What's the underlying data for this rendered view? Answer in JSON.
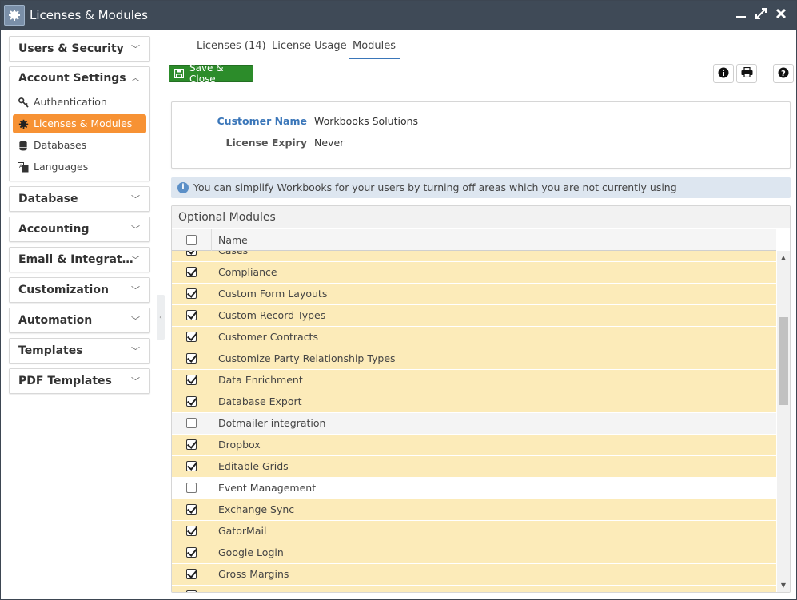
{
  "window": {
    "title": "Licenses & Modules"
  },
  "sidebar": {
    "groups": [
      {
        "label": "Users & Security"
      },
      {
        "label": "Account Settings",
        "items": [
          {
            "label": "Authentication",
            "icon": "key-icon"
          },
          {
            "label": "Licenses & Modules",
            "icon": "gear-icon",
            "active": true
          },
          {
            "label": "Databases",
            "icon": "database-icon"
          },
          {
            "label": "Languages",
            "icon": "language-icon"
          }
        ]
      },
      {
        "label": "Database"
      },
      {
        "label": "Accounting"
      },
      {
        "label": "Email & Integrat…"
      },
      {
        "label": "Customization"
      },
      {
        "label": "Automation"
      },
      {
        "label": "Templates"
      },
      {
        "label": "PDF Templates"
      }
    ]
  },
  "tabs": [
    {
      "label": "Licenses (14)"
    },
    {
      "label": "License Usage"
    },
    {
      "label": "Modules",
      "active": true
    }
  ],
  "toolbar": {
    "save_label": "Save & Close"
  },
  "details": {
    "customer_name_label": "Customer Name",
    "customer_name_value": "Workbooks Solutions",
    "license_expiry_label": "License Expiry",
    "license_expiry_value": "Never"
  },
  "notice": "You can simplify Workbooks for your users by turning off areas which you are not currently using",
  "modules": {
    "title": "Optional Modules",
    "column_name": "Name",
    "rows": [
      {
        "name": "Cases",
        "checked": true
      },
      {
        "name": "Compliance",
        "checked": true
      },
      {
        "name": "Custom Form Layouts",
        "checked": true
      },
      {
        "name": "Custom Record Types",
        "checked": true
      },
      {
        "name": "Customer Contracts",
        "checked": true
      },
      {
        "name": "Customize Party Relationship Types",
        "checked": true
      },
      {
        "name": "Data Enrichment",
        "checked": true
      },
      {
        "name": "Database Export",
        "checked": true
      },
      {
        "name": "Dotmailer integration",
        "checked": false
      },
      {
        "name": "Dropbox",
        "checked": true
      },
      {
        "name": "Editable Grids",
        "checked": true
      },
      {
        "name": "Event Management",
        "checked": false
      },
      {
        "name": "Exchange Sync",
        "checked": true
      },
      {
        "name": "GatorMail",
        "checked": true
      },
      {
        "name": "Google Login",
        "checked": true
      },
      {
        "name": "Gross Margins",
        "checked": true
      },
      {
        "name": "",
        "checked": true
      }
    ]
  },
  "colors": {
    "titlebar": "#3f4a57",
    "active_item": "#f79234",
    "save_button": "#2c8c2a",
    "checked_row": "#fcebb9",
    "tab_underline": "#3a76b9"
  }
}
